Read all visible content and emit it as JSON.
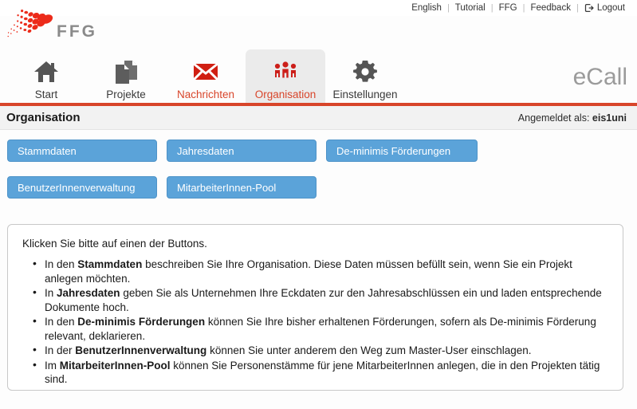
{
  "utility_nav": {
    "items": [
      {
        "label": "English",
        "icon": null
      },
      {
        "label": "Tutorial",
        "icon": null
      },
      {
        "label": "FFG",
        "icon": null
      },
      {
        "label": "Feedback",
        "icon": null
      }
    ],
    "separator": "|",
    "logout": {
      "label": "Logout",
      "icon": "logout-icon"
    }
  },
  "brand": {
    "logo_icon": "ffg-swoosh-logo",
    "logo_text": "FFG",
    "wordmark": "eCall",
    "accent_color": "#d8452a",
    "logo_gray": "#8a8a8a"
  },
  "nav": {
    "tabs": [
      {
        "label": "Start",
        "icon": "home-icon",
        "active": false,
        "highlight": false
      },
      {
        "label": "Projekte",
        "icon": "documents-icon",
        "active": false,
        "highlight": false
      },
      {
        "label": "Nachrichten",
        "icon": "envelope-icon",
        "active": false,
        "highlight": true
      },
      {
        "label": "Organisation",
        "icon": "people-group-icon",
        "active": true,
        "highlight": true
      },
      {
        "label": "Einstellungen",
        "icon": "gear-icon",
        "active": false,
        "highlight": false
      }
    ]
  },
  "page_header": {
    "title": "Organisation",
    "logged_in_prefix": "Angemeldet als:",
    "username": "eis1uni"
  },
  "action_buttons": {
    "row1": [
      {
        "label": "Stammdaten"
      },
      {
        "label": "Jahresdaten"
      },
      {
        "label": "De-minimis Förderungen"
      }
    ],
    "row2": [
      {
        "label": "BenutzerInnenverwaltung"
      },
      {
        "label": "MitarbeiterInnen-Pool"
      }
    ],
    "color": "#5ba3d9"
  },
  "content": {
    "intro": "Klicken Sie bitte auf einen der Buttons.",
    "bullets": [
      {
        "pre": "In den ",
        "bold": "Stammdaten",
        "post": " beschreiben Sie Ihre Organisation. Diese Daten müssen befüllt sein, wenn Sie ein Projekt anlegen möchten."
      },
      {
        "pre": "In ",
        "bold": "Jahresdaten",
        "post": " geben Sie als Unternehmen Ihre Eckdaten zur den Jahresabschlüssen ein und laden entsprechende Dokumente hoch."
      },
      {
        "pre": "In den ",
        "bold": "De-minimis Förderungen",
        "post": " können Sie Ihre bisher erhaltenen Förderungen, sofern als De-minimis Förderung relevant, deklarieren."
      },
      {
        "pre": "In der ",
        "bold": "BenutzerInnenverwaltung",
        "post": " können Sie unter anderem den Weg zum Master-User einschlagen."
      },
      {
        "pre": "Im ",
        "bold": "MitarbeiterInnen-Pool",
        "post": " können Sie Personenstämme für jene MitarbeiterInnen anlegen, die in den Projekten tätig sind."
      }
    ]
  }
}
